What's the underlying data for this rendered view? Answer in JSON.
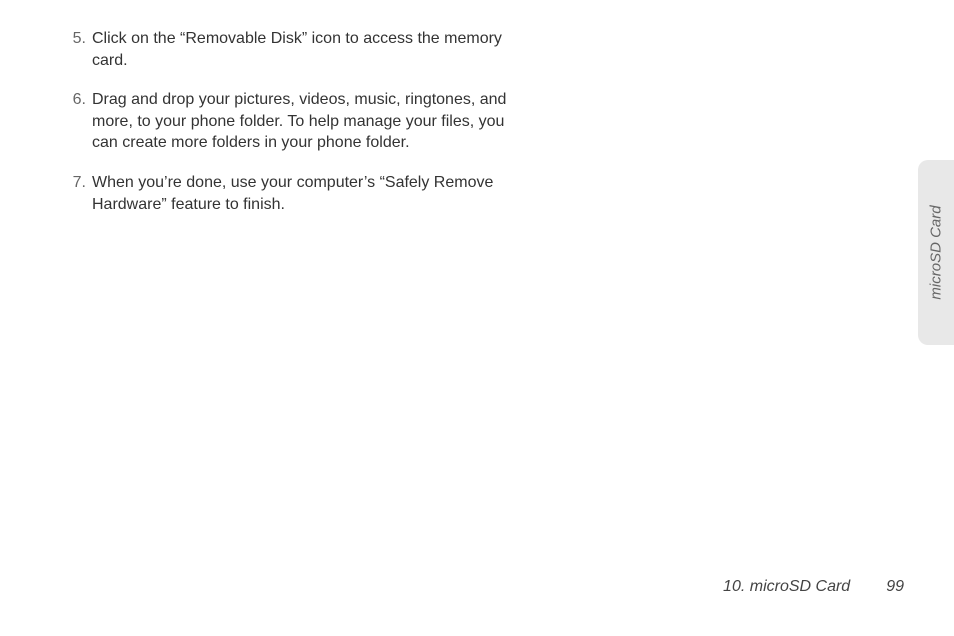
{
  "steps": [
    {
      "num": "5.",
      "text": "Click on the “Removable Disk” icon to access the memory card."
    },
    {
      "num": "6.",
      "text": "Drag and drop your pictures, videos, music, ringtones, and more, to your phone folder. To help manage your files, you can create more folders in your phone folder."
    },
    {
      "num": "7.",
      "text": "When you’re done, use your computer’s “Safely Remove Hardware” feature to finish."
    }
  ],
  "sideTab": "microSD Card",
  "footer": {
    "section": "10. microSD Card",
    "page": "99"
  }
}
